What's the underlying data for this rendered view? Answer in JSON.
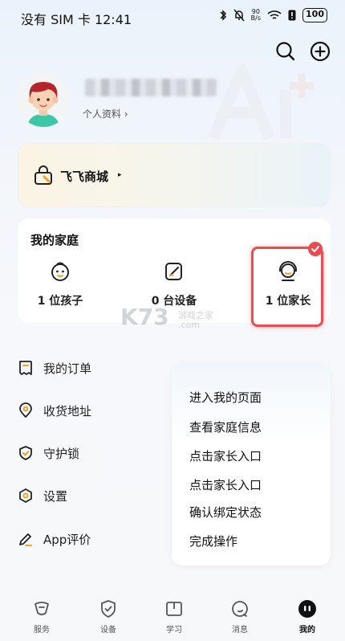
{
  "status_bar": {
    "carrier_time": "没有 SIM 卡 12:41",
    "net_speed_value": "90",
    "net_speed_unit": "B/s",
    "battery": "100"
  },
  "profile": {
    "link_label": "个人资料 ›"
  },
  "mall": {
    "label": "飞飞商城",
    "caret": "▸"
  },
  "family": {
    "title": "我的家庭",
    "items": [
      {
        "label": "1 位孩子"
      },
      {
        "label": "0 台设备"
      },
      {
        "label": "1 位家长"
      }
    ]
  },
  "menu": [
    {
      "label": "我的订单",
      "icon": "order-icon"
    },
    {
      "label": "收货地址",
      "icon": "location-icon"
    },
    {
      "label": "守护锁",
      "icon": "shield-lock-icon"
    },
    {
      "label": "设置",
      "icon": "settings-icon"
    },
    {
      "label": "App评价",
      "icon": "pen-icon"
    }
  ],
  "steps": [
    "进入我的页面",
    "查看家庭信息",
    "点击家长入口",
    "点击家长入口",
    "确认绑定状态",
    "完成操作"
  ],
  "watermark": {
    "brand": "K73",
    "sub": "游戏之家",
    "domain": ".com"
  },
  "bottom_nav": [
    {
      "label": "服务",
      "icon": "service-icon",
      "active": false
    },
    {
      "label": "设备",
      "icon": "device-icon",
      "active": false
    },
    {
      "label": "学习",
      "icon": "study-icon",
      "active": false
    },
    {
      "label": "消息",
      "icon": "message-icon",
      "active": false
    },
    {
      "label": "我的",
      "icon": "me-icon",
      "active": true
    }
  ],
  "colors": {
    "highlight": "#ea4d52",
    "text": "#222222"
  }
}
